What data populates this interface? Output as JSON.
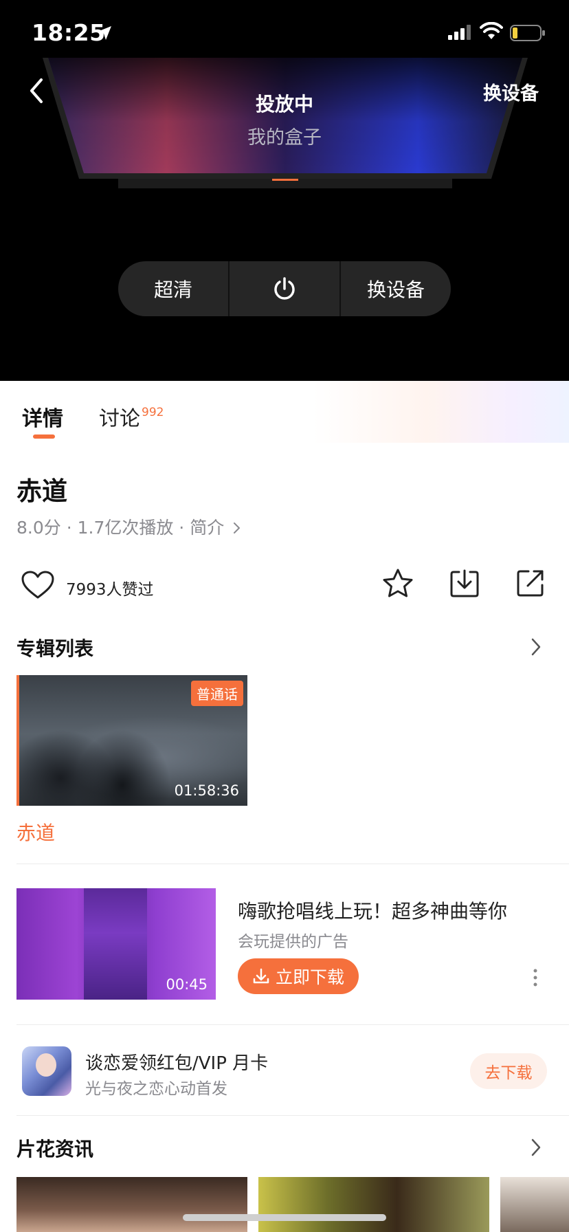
{
  "status_bar": {
    "time": "18:25"
  },
  "header": {
    "cast_status": "投放中",
    "device_name": "我的盒子",
    "switch_device": "换设备"
  },
  "controls": {
    "quality": "超清",
    "switch_device": "换设备"
  },
  "tabs": {
    "details": "详情",
    "discussion": "讨论",
    "discussion_count": "992"
  },
  "video": {
    "title": "赤道",
    "meta_text": "8.0分 · 1.7亿次播放 · 简介"
  },
  "actions": {
    "likes": "7993人赞过"
  },
  "album": {
    "heading": "专辑列表",
    "episode": {
      "badge": "普通话",
      "duration": "01:58:36",
      "name": "赤道"
    }
  },
  "ad": {
    "duration": "00:45",
    "title": "嗨歌抢唱线上玩！超多神曲等你",
    "subtitle": "会玩提供的广告",
    "button": "立即下载"
  },
  "promo": {
    "title": "谈恋爱领红包/VIP 月卡",
    "subtitle": "光与夜之恋心动首发",
    "button": "去下载"
  },
  "clips": {
    "heading": "片花资讯"
  },
  "colors": {
    "accent": "#f5703c",
    "control_bg": "#262626"
  }
}
